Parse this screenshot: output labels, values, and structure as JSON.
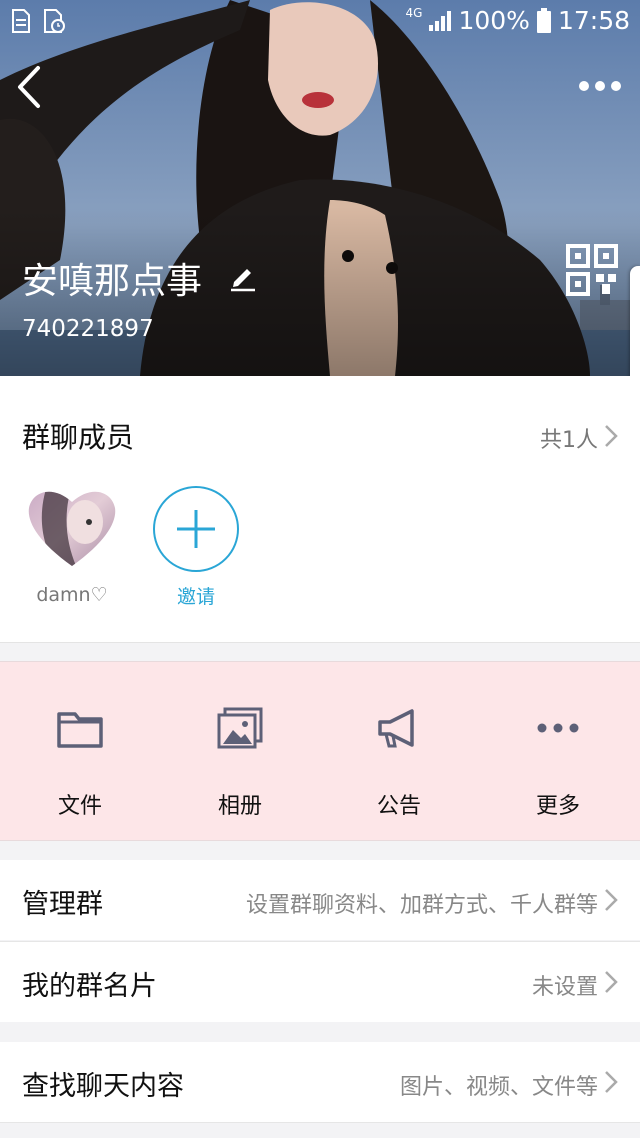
{
  "status_bar": {
    "network": "4G",
    "battery": "100%",
    "time": "17:58"
  },
  "header": {
    "group_name": "安嗔那点事",
    "group_id": "740221897"
  },
  "members": {
    "title": "群聊成员",
    "count": "共1人",
    "list": [
      {
        "name": "damn♡"
      }
    ],
    "invite_label": "邀请"
  },
  "tools": [
    {
      "label": "文件",
      "icon": "folder-icon"
    },
    {
      "label": "相册",
      "icon": "album-icon"
    },
    {
      "label": "公告",
      "icon": "megaphone-icon"
    },
    {
      "label": "更多",
      "icon": "more-icon"
    }
  ],
  "settings": [
    {
      "label": "管理群",
      "value": "设置群聊资料、加群方式、千人群等"
    },
    {
      "label": "我的群名片",
      "value": "未设置"
    },
    {
      "label": "查找聊天内容",
      "value": "图片、视频、文件等"
    }
  ],
  "colors": {
    "accent": "#2aa6d6",
    "tools_bg": "#fde6e8"
  }
}
